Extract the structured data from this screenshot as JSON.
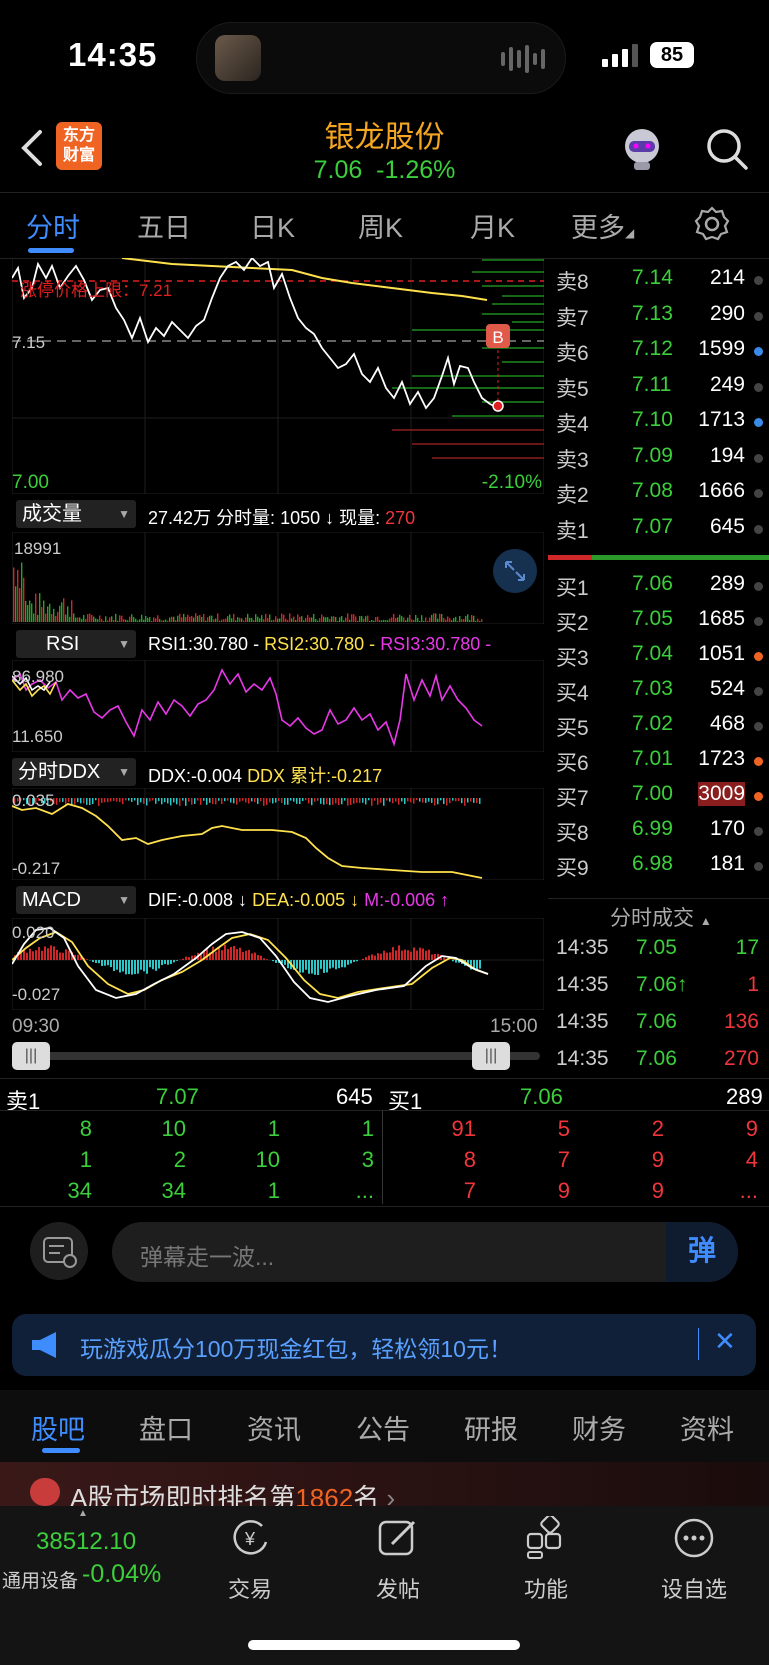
{
  "status": {
    "time": "14:35",
    "battery": "85"
  },
  "header": {
    "logo_line1": "东方",
    "logo_line2": "财富",
    "title": "银龙股份",
    "price": "7.06",
    "change": "-1.26%"
  },
  "tabs": [
    "分时",
    "五日",
    "日K",
    "周K",
    "月K",
    "更多"
  ],
  "price_chart": {
    "limit_label": "涨停价格上限：7.21",
    "ref_price": "7.15",
    "low_price": "7.00",
    "low_pct": "-2.10%",
    "marker": "B"
  },
  "volume": {
    "label": "成交量",
    "total": "27.42万",
    "split_label": "分时量: 1050 ↓",
    "now_label": "现量:",
    "now_value": "270",
    "max": "18991"
  },
  "rsi": {
    "label": "RSI",
    "rsi1": "RSI1:30.780 -",
    "rsi2": "RSI2:30.780 -",
    "rsi3": "RSI3:30.780 -",
    "top": "86.980",
    "bottom": "11.650"
  },
  "ddx": {
    "label": "分时DDX",
    "ddx": "DDX:-0.004",
    "cum": "DDX 累计:-0.217",
    "top": "0.035",
    "bottom": "-0.217"
  },
  "macd": {
    "label": "MACD",
    "dif": "DIF:-0.008 ↓",
    "dea": "DEA:-0.005 ↓",
    "m": "M:-0.006 ↑",
    "top": "0.020",
    "bottom": "-0.027"
  },
  "time_axis": {
    "start": "09:30",
    "end": "15:00"
  },
  "sell_orders": [
    {
      "name": "卖8",
      "price": "7.14",
      "vol": "214"
    },
    {
      "name": "卖7",
      "price": "7.13",
      "vol": "290"
    },
    {
      "name": "卖6",
      "price": "7.12",
      "vol": "1599"
    },
    {
      "name": "卖5",
      "price": "7.11",
      "vol": "249"
    },
    {
      "name": "卖4",
      "price": "7.10",
      "vol": "1713"
    },
    {
      "name": "卖3",
      "price": "7.09",
      "vol": "194"
    },
    {
      "name": "卖2",
      "price": "7.08",
      "vol": "1666"
    },
    {
      "name": "卖1",
      "price": "7.07",
      "vol": "645"
    }
  ],
  "buy_orders": [
    {
      "name": "买1",
      "price": "7.06",
      "vol": "289"
    },
    {
      "name": "买2",
      "price": "7.05",
      "vol": "1685"
    },
    {
      "name": "买3",
      "price": "7.04",
      "vol": "1051"
    },
    {
      "name": "买4",
      "price": "7.03",
      "vol": "524"
    },
    {
      "name": "买5",
      "price": "7.02",
      "vol": "468"
    },
    {
      "name": "买6",
      "price": "7.01",
      "vol": "1723"
    },
    {
      "name": "买7",
      "price": "7.00",
      "vol": "3009"
    },
    {
      "name": "买8",
      "price": "6.99",
      "vol": "170"
    },
    {
      "name": "买9",
      "price": "6.98",
      "vol": "181"
    }
  ],
  "trades": {
    "label": "分时成交",
    "rows": [
      {
        "time": "14:35",
        "price": "7.05",
        "vol": "17"
      },
      {
        "time": "14:35",
        "price": "7.06↑",
        "vol": "1"
      },
      {
        "time": "14:35",
        "price": "7.06",
        "vol": "136"
      },
      {
        "time": "14:35",
        "price": "7.06",
        "vol": "270"
      }
    ]
  },
  "queue": {
    "sell_label": "卖1",
    "sell_price": "7.07",
    "sell_vol": "645",
    "buy_label": "买1",
    "buy_price": "7.06",
    "buy_vol": "289",
    "sell_rows": [
      [
        "8",
        "10",
        "1",
        "1"
      ],
      [
        "1",
        "2",
        "10",
        "3"
      ],
      [
        "34",
        "34",
        "1",
        "..."
      ]
    ],
    "buy_rows": [
      [
        "91",
        "5",
        "2",
        "9"
      ],
      [
        "8",
        "7",
        "9",
        "4"
      ],
      [
        "7",
        "9",
        "9",
        "..."
      ]
    ]
  },
  "danmu": {
    "placeholder": "弹幕走一波...",
    "send": "弹"
  },
  "banner": {
    "text": "玩游戏瓜分100万现金红包，轻松领10元！"
  },
  "section_tabs": [
    "股吧",
    "盘口",
    "资讯",
    "公告",
    "研报",
    "财务",
    "资料"
  ],
  "rank": {
    "prefix": "A股市场即时排名第",
    "rank": "1862",
    "suffix": "名"
  },
  "bottom_nav": {
    "index_value": "38512.10",
    "index_name": "通用设备",
    "index_change": "-0.04%",
    "trade": "交易",
    "post": "发帖",
    "func": "功能",
    "watch": "设自选"
  },
  "colors": {
    "up": "#f0363c",
    "down": "#3ccf3c",
    "accent": "#3f8cff",
    "title": "#f5a623"
  }
}
